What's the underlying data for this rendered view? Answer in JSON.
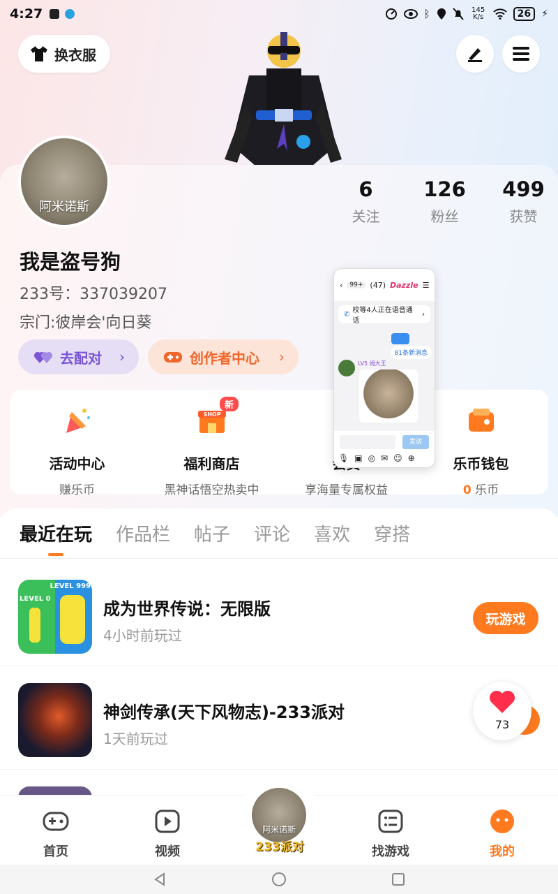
{
  "status_bar": {
    "time": "4:27",
    "net_speed": "145 K/s",
    "battery": "26"
  },
  "header": {
    "wardrobe_label": "换衣服"
  },
  "profile": {
    "avatar_name": "阿米诺斯",
    "username": "我是盗号狗",
    "id_label": "233号：337039207",
    "sect": "宗门:彼岸会'向日葵",
    "stats": [
      {
        "value": "6",
        "label": "关注"
      },
      {
        "value": "126",
        "label": "粉丝"
      },
      {
        "value": "499",
        "label": "获赞"
      }
    ],
    "pair_button": "去配对",
    "creator_button": "创作者中心"
  },
  "services": [
    {
      "title": "活动中心",
      "sub": "赚乐币",
      "icon": "party-popper-icon"
    },
    {
      "title": "福利商店",
      "sub": "黑神话悟空热卖中",
      "icon": "shop-icon",
      "badge": "新",
      "shop_text": "SHOP"
    },
    {
      "title": "会员",
      "sub": "享海量专属权益",
      "icon": "vip-icon"
    },
    {
      "title": "乐币钱包",
      "sub_value": "0",
      "sub_unit": " 乐币",
      "icon": "wallet-icon"
    }
  ],
  "tabs": [
    "最近在玩",
    "作品栏",
    "帖子",
    "评论",
    "喜欢",
    "穿搭"
  ],
  "games": [
    {
      "name": "成为世界传说：无限版",
      "time": "4小时前玩过",
      "action": "玩游戏",
      "thumb_left": "LEVEL 0",
      "thumb_right": "LEVEL 999"
    },
    {
      "name": "神剑传承(天下风物志)-233派对",
      "time": "1天前玩过"
    }
  ],
  "like_count": "73",
  "floating_window": {
    "unread": "99+",
    "group_title": "(47)",
    "group_tag": "Dazzle",
    "voice_notice": "校等4人正在语音通话",
    "new_msgs": "81条新消息",
    "sender_level": "LV5",
    "sender_name": "姆大王",
    "send_label": "发送"
  },
  "bottom_nav": [
    {
      "label": "首页",
      "icon": "gamepad-icon"
    },
    {
      "label": "视频",
      "icon": "video-play-icon"
    },
    {
      "label": "找游戏",
      "icon": "game-list-icon"
    },
    {
      "label": "我的",
      "icon": "my-face-icon"
    }
  ],
  "center_nav": {
    "avatar_name": "阿米诺斯",
    "label": "233派对"
  },
  "colors": {
    "accent": "#ff7a1e",
    "pair_purple": "#7a55d6",
    "creator_orange": "#f0662a"
  }
}
